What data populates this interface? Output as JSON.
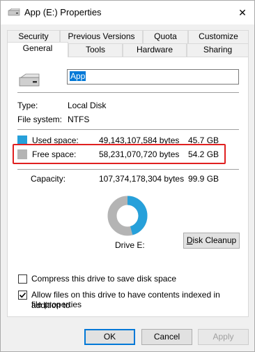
{
  "window": {
    "title": "App (E:) Properties",
    "close_glyph": "✕"
  },
  "tabs": {
    "row1": [
      "Security",
      "Previous Versions",
      "Quota",
      "Customize"
    ],
    "row2": [
      "General",
      "Tools",
      "Hardware",
      "Sharing"
    ],
    "active": "General"
  },
  "general": {
    "drive_name": "App",
    "type_label": "Type:",
    "type_value": "Local Disk",
    "fs_label": "File system:",
    "fs_value": "NTFS",
    "used_label": "Used space:",
    "used_bytes": "49,143,107,584 bytes",
    "used_size": "45.7 GB",
    "free_label": "Free space:",
    "free_bytes": "58,231,070,720 bytes",
    "free_size": "54.2 GB",
    "capacity_label": "Capacity:",
    "capacity_bytes": "107,374,178,304 bytes",
    "capacity_size": "99.9 GB",
    "drive_label": "Drive E:",
    "disk_cleanup": "Disk Cleanup",
    "used_fraction": 0.4577,
    "used_color": "#26a0da",
    "free_color": "#b4b4b4",
    "compress_label": "Compress this drive to save disk space",
    "compress_checked": false,
    "index_label_line1": "Allow files on this drive to have contents indexed in addition to",
    "index_label_line2": "file properties",
    "index_checked": true
  },
  "buttons": {
    "ok": "OK",
    "cancel": "Cancel",
    "apply": "Apply"
  },
  "highlight_color": "#e02020"
}
